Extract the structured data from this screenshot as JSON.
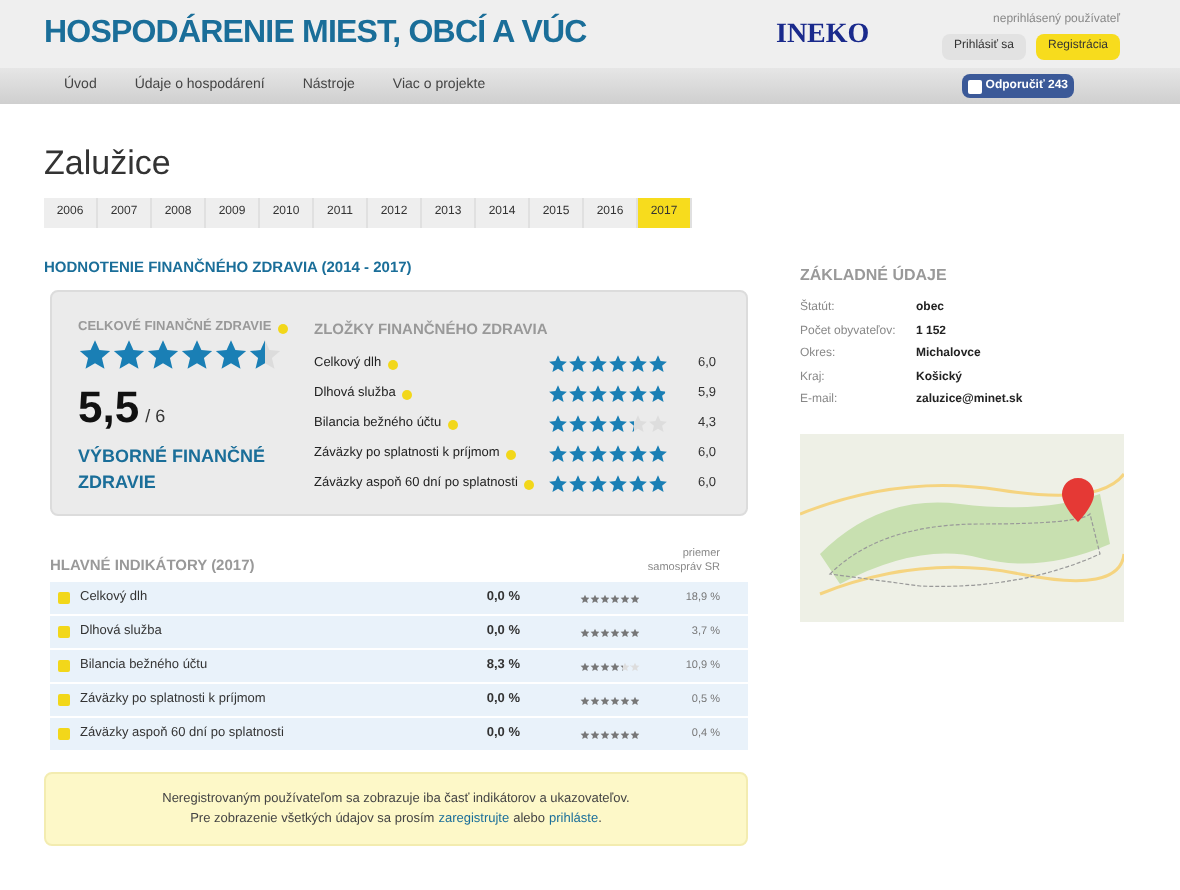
{
  "header": {
    "title": "HOSPODÁRENIE MIEST, OBCÍ A VÚC",
    "logo": "INEKO",
    "user_status": "neprihlásený používateľ",
    "login_button": "Prihlásiť sa",
    "register_button": "Registrácia"
  },
  "nav": {
    "items": [
      "Úvod",
      "Údaje o hospodárení",
      "Nástroje",
      "Viac o projekte"
    ],
    "share_button": "Odporučiť 243"
  },
  "page_title": "Zalužice",
  "year_tabs": [
    {
      "label": "2006",
      "selected": false
    },
    {
      "label": "2007",
      "selected": false
    },
    {
      "label": "2008",
      "selected": false
    },
    {
      "label": "2009",
      "selected": false
    },
    {
      "label": "2010",
      "selected": false
    },
    {
      "label": "2011",
      "selected": false
    },
    {
      "label": "2012",
      "selected": false
    },
    {
      "label": "2013",
      "selected": false
    },
    {
      "label": "2014",
      "selected": false
    },
    {
      "label": "2015",
      "selected": false
    },
    {
      "label": "2016",
      "selected": false
    },
    {
      "label": "2017",
      "selected": true
    }
  ],
  "health": {
    "heading": "HODNOTENIE FINANČNÉHO ZDRAVIA (2014 - 2017)",
    "overall": {
      "label": "CELKOVÉ FINANČNÉ ZDRAVIE",
      "stars": 5.5
    },
    "score": "5,5",
    "score_max": "/ 6",
    "verdict": "VÝBORNÉ FINANČNÉ ZDRAVIE",
    "components_label": "ZLOŽKY FINANČNÉHO ZDRAVIA",
    "components": [
      {
        "name": "Celkový dlh",
        "stars": 6,
        "value": "6,0"
      },
      {
        "name": "Dlhová služba",
        "stars": 5.9,
        "value": "5,9"
      },
      {
        "name": "Bilancia bežného účtu",
        "stars": 4.3,
        "value": "4,3"
      },
      {
        "name": "Záväzky po splatnosti k príjmom",
        "stars": 6,
        "value": "6,0"
      },
      {
        "name": "Záväzky aspoň 60 dní po splatnosti",
        "stars": 6,
        "value": "6,0"
      }
    ]
  },
  "indicators": {
    "heading": "HLAVNÉ INDIKÁTORY (2017)",
    "average_header": "priemer samospráv SR",
    "rows": [
      {
        "name": "Celkový dlh",
        "value": "0,0 %",
        "stars": 6,
        "average": "18,9 %"
      },
      {
        "name": "Dlhová služba",
        "value": "0,0 %",
        "stars": 6,
        "average": "3,7 %"
      },
      {
        "name": "Bilancia bežného účtu",
        "value": "8,3 %",
        "stars": 4.3,
        "average": "10,9 %"
      },
      {
        "name": "Záväzky po splatnosti k príjmom",
        "value": "0,0 %",
        "stars": 6,
        "average": "0,5 %"
      },
      {
        "name": "Záväzky aspoň 60 dní po splatnosti",
        "value": "0,0 %",
        "stars": 6,
        "average": "0,4 %"
      }
    ]
  },
  "notice": {
    "line_1": "Neregistrovaným používateľom sa zobrazuje iba časť indikátorov a ukazovateľov.",
    "line_2_before": "Pre zobrazenie všetkých údajov sa prosím",
    "register_link": "zaregistrujte",
    "line_2_middle": "alebo",
    "login_link": "prihláste",
    "line_2_end": "."
  },
  "basic_info": {
    "heading": "ZÁKLADNÉ ÚDAJE",
    "rows": [
      {
        "label": "Štatút:",
        "value": "obec"
      },
      {
        "label": "Počet obyvateľov:",
        "value": "1 152"
      },
      {
        "label": "Okres:",
        "value": "Michalovce"
      },
      {
        "label": "Kraj:",
        "value": "Košický"
      },
      {
        "label": "E-mail:",
        "value": "zaluzice@minet.sk"
      }
    ]
  }
}
